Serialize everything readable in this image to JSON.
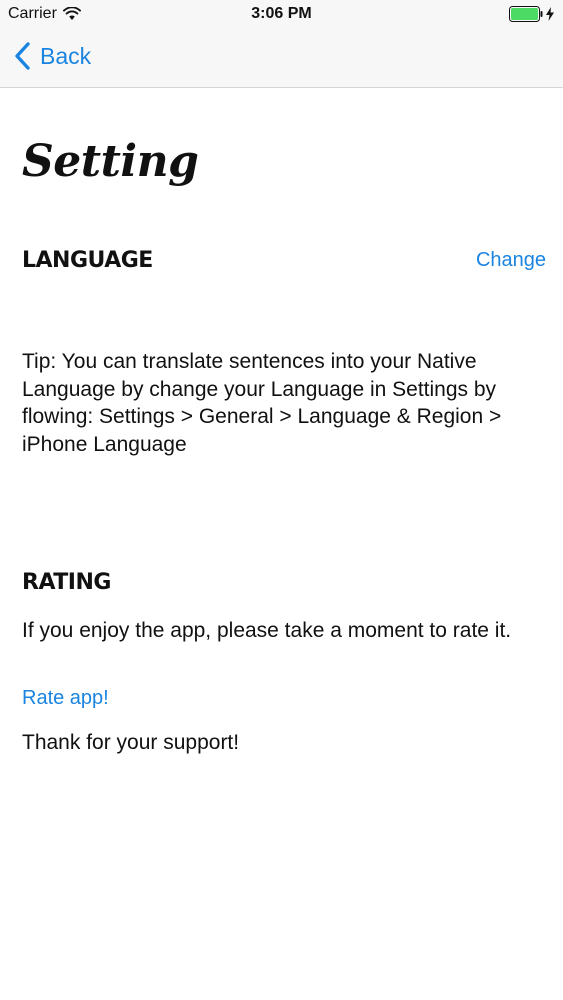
{
  "status_bar": {
    "carrier": "Carrier",
    "time": "3:06 PM",
    "icons": [
      "wifi-icon",
      "battery-icon",
      "charging-bolt-icon"
    ]
  },
  "nav": {
    "back_label": "Back",
    "back_icon": "chevron-left-icon"
  },
  "page": {
    "title": "Setting"
  },
  "language_section": {
    "heading": "LANGUAGE",
    "change_label": "Change",
    "tip": "Tip: You can translate sentences into your Native Language by change your Language in Settings by flowing: Settings > General > Language & Region > iPhone Language"
  },
  "rating_section": {
    "heading": "RATING",
    "description": "If you enjoy the app, please take a moment to rate it.",
    "rate_label": "Rate app!",
    "thanks": "Thank for your support!"
  },
  "colors": {
    "accent": "#1a84e0",
    "battery": "#4cd964",
    "text": "#111111",
    "bar_background": "#f7f7f7"
  }
}
